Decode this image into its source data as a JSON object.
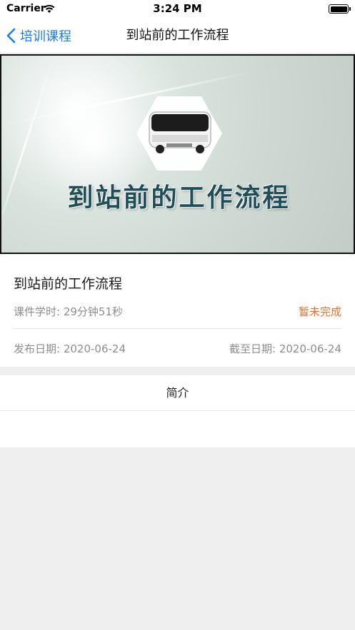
{
  "status_bar": {
    "carrier": "Carrier",
    "time": "3:24 PM"
  },
  "nav": {
    "back_label": "培训课程",
    "title": "到站前的工作流程"
  },
  "video": {
    "caption": "到站前的工作流程"
  },
  "course": {
    "title": "到站前的工作流程",
    "duration": "课件学时: 29分钟51秒",
    "status": "暂未完成",
    "publish_date": "发布日期: 2020-06-24",
    "deadline": "截至日期: 2020-06-24"
  },
  "tabs": {
    "intro_label": "简介"
  },
  "colors": {
    "accent": "#1a7cf2",
    "status": "#ef6d2b",
    "background": "#efefef"
  }
}
